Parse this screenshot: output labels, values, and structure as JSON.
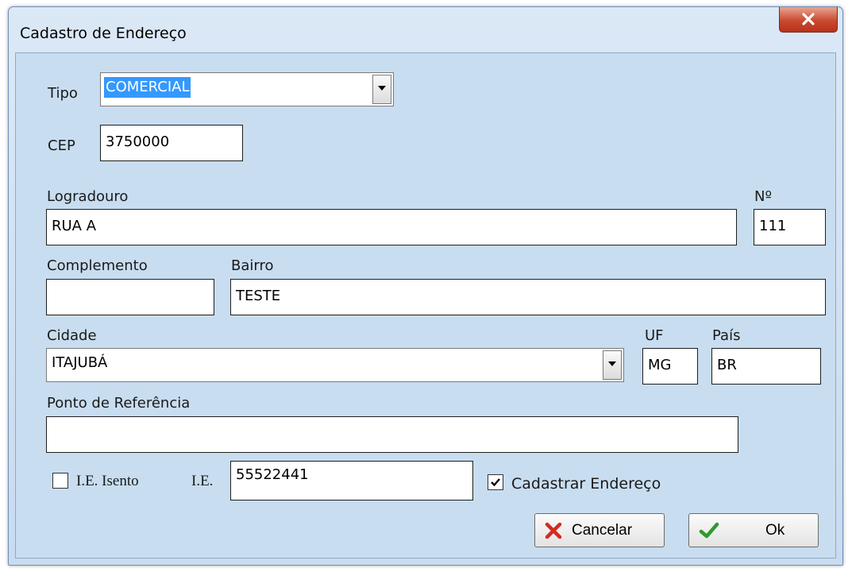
{
  "window": {
    "title": "Cadastro de Endereço",
    "close_icon": "close-icon"
  },
  "form": {
    "tipo": {
      "label": "Tipo",
      "value": "COMERCIAL"
    },
    "cep": {
      "label": "CEP",
      "value": "3750000"
    },
    "logradouro": {
      "label": "Logradouro",
      "value": "RUA A"
    },
    "numero": {
      "label": "Nº",
      "value": "111"
    },
    "complemento": {
      "label": "Complemento",
      "value": ""
    },
    "bairro": {
      "label": "Bairro",
      "value": "TESTE"
    },
    "cidade": {
      "label": "Cidade",
      "value": "ITAJUBÁ"
    },
    "uf": {
      "label": "UF",
      "value": "MG"
    },
    "pais": {
      "label": "País",
      "value": "BR"
    },
    "ponto_referencia": {
      "label": "Ponto de Referência",
      "value": ""
    },
    "ie_isento": {
      "label": "I.E. Isento",
      "checked": false
    },
    "ie": {
      "label": "I.E.",
      "value": "55522441"
    },
    "cadastrar_endereco": {
      "label": "Cadastrar Endereço",
      "checked": true
    }
  },
  "buttons": {
    "cancel": {
      "label": "Cancelar",
      "icon": "x-icon",
      "icon_color": "#d42a1f"
    },
    "ok": {
      "label": "Ok",
      "icon": "checkmark-icon",
      "icon_color": "#2e9a2e"
    }
  },
  "colors": {
    "selection": "#3399ff",
    "client_bg": "#c8ddf0",
    "close_button": "#c94a2f"
  }
}
